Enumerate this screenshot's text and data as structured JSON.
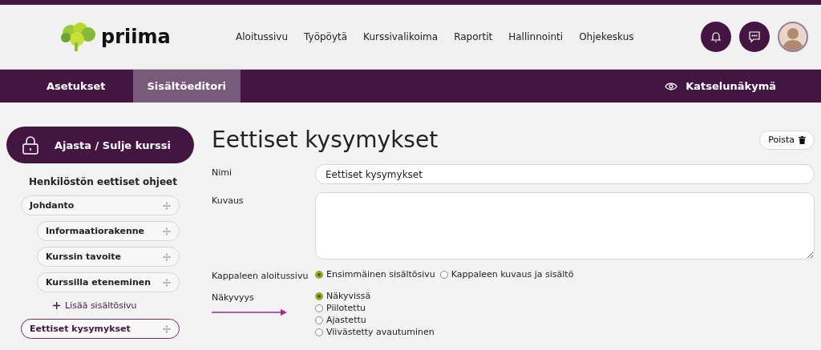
{
  "header": {
    "logo_text": "priima",
    "nav": [
      {
        "label": "Aloitussivu"
      },
      {
        "label": "Työpöytä"
      },
      {
        "label": "Kurssivalikoima"
      },
      {
        "label": "Raportit"
      },
      {
        "label": "Hallinnointi"
      },
      {
        "label": "Ohjekeskus"
      }
    ]
  },
  "tabs": [
    {
      "label": "Asetukset",
      "selected": false
    },
    {
      "label": "Sisältöeditori",
      "selected": true
    }
  ],
  "preview_link": "Katselunäkymä",
  "sidebar": {
    "lock_button": "Ajasta / Sulje kurssi",
    "course_title": "Henkilöstön eettiset ohjeet",
    "items": [
      {
        "label": "Johdanto",
        "selected": false,
        "children": [
          {
            "label": "Informaatiorakenne",
            "selected": false
          },
          {
            "label": "Kurssin tavoite",
            "selected": false
          },
          {
            "label": "Kurssilla eteneminen",
            "selected": false
          }
        ],
        "add_link": "Lisää sisältösivu"
      },
      {
        "label": "Eettiset kysymykset",
        "selected": true
      }
    ]
  },
  "editor": {
    "title": "Eettiset kysymykset",
    "delete_button": "Poista",
    "fields": [
      {
        "kind": "text",
        "label": "Nimi",
        "value": "Eettiset kysymykset"
      },
      {
        "kind": "textarea",
        "label": "Kuvaus"
      },
      {
        "kind": "radio-inline",
        "label": "Kappaleen aloitussivu",
        "options": [
          {
            "label": "Ensimmäinen sisältösivu",
            "selected": true
          },
          {
            "label": "Kappaleen kuvaus ja sisältö",
            "selected": false
          }
        ]
      },
      {
        "kind": "radio-stack",
        "label": "Näkyvyys",
        "arrow": true,
        "options": [
          {
            "label": "Näkyvissä",
            "selected": true
          },
          {
            "label": "Piilotettu",
            "selected": false
          },
          {
            "label": "Ajastettu",
            "selected": false
          },
          {
            "label": "Viivästetty avautuminen",
            "selected": false
          }
        ]
      }
    ]
  }
}
